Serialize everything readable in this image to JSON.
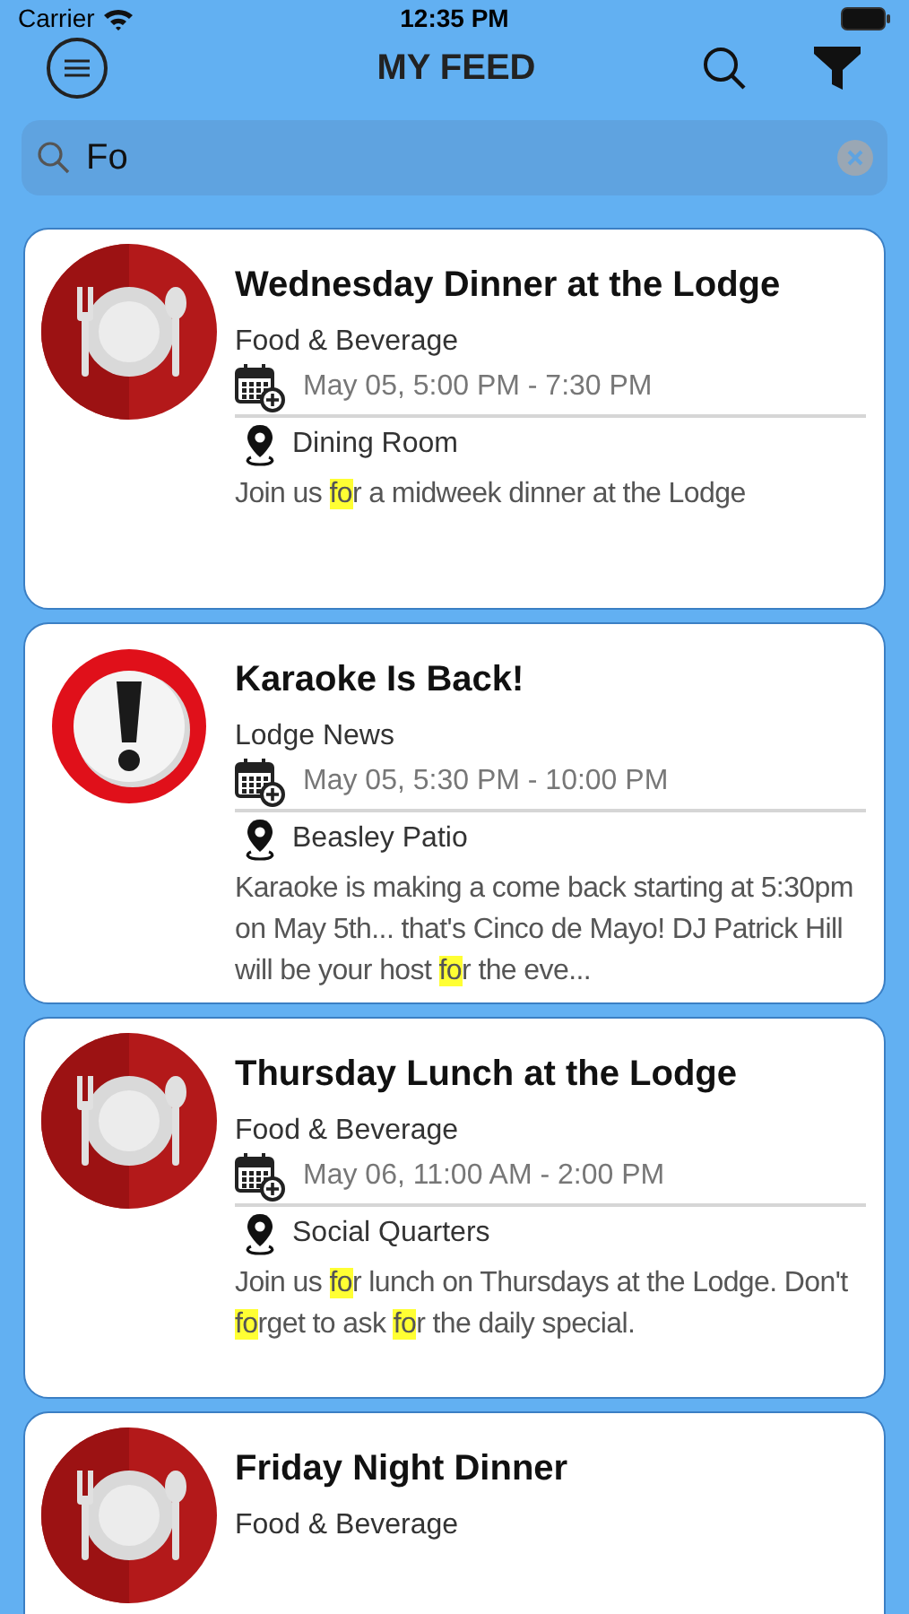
{
  "status_bar": {
    "carrier": "Carrier",
    "time": "12:35 PM"
  },
  "header": {
    "title": "MY FEED"
  },
  "search": {
    "value": "Fo"
  },
  "events": [
    {
      "kind": "dinner",
      "title": "Wednesday Dinner at the Lodge",
      "category": "Food & Beverage",
      "when": "May 05, 5:00 PM - 7:30 PM",
      "where": "Dining Room",
      "description": [
        {
          "text": "Join us ",
          "highlight": false
        },
        {
          "text": "fo",
          "highlight": true
        },
        {
          "text": "r a midweek dinner at the Lodge",
          "highlight": false
        }
      ]
    },
    {
      "kind": "alert",
      "title": "Karaoke Is Back!",
      "category": "Lodge News",
      "when": "May 05, 5:30 PM - 10:00 PM",
      "where": "Beasley Patio",
      "description": [
        {
          "text": "Karaoke is making a come back starting at 5:30pm on May 5th... that's Cinco de Mayo! DJ Patrick Hill will be your host ",
          "highlight": false
        },
        {
          "text": "fo",
          "highlight": true
        },
        {
          "text": "r the eve...",
          "highlight": false
        }
      ]
    },
    {
      "kind": "dinner",
      "title": "Thursday Lunch at the Lodge",
      "category": "Food & Beverage",
      "when": "May 06, 11:00 AM - 2:00 PM",
      "where": "Social Quarters",
      "description": [
        {
          "text": "Join us ",
          "highlight": false
        },
        {
          "text": "fo",
          "highlight": true
        },
        {
          "text": "r lunch on Thursdays at the Lodge. Don't ",
          "highlight": false
        },
        {
          "text": "fo",
          "highlight": true
        },
        {
          "text": "rget to ask ",
          "highlight": false
        },
        {
          "text": "fo",
          "highlight": true
        },
        {
          "text": "r the daily special.",
          "highlight": false
        }
      ]
    },
    {
      "kind": "dinner",
      "title": "Friday Night Dinner",
      "category": "Food & Beverage"
    }
  ]
}
